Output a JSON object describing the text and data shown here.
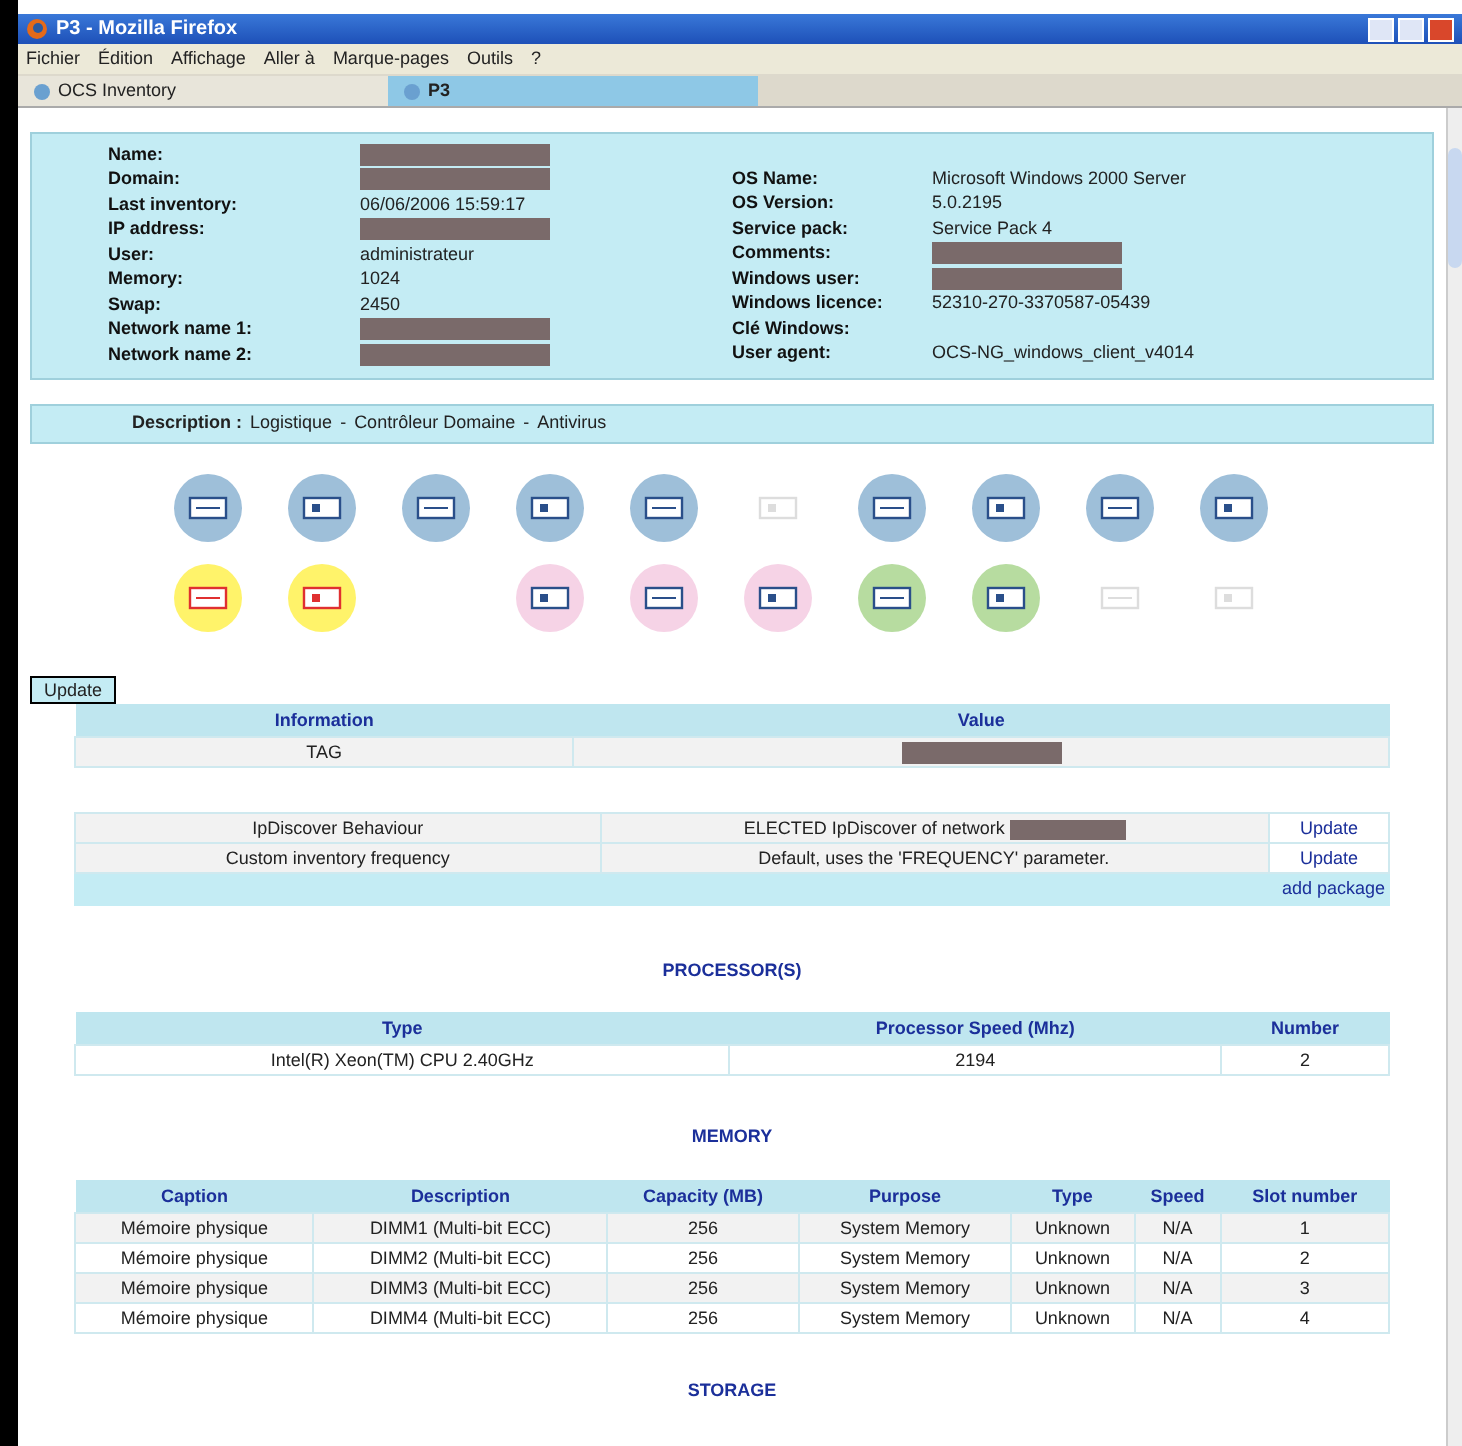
{
  "window": {
    "title": "P3 - Mozilla Firefox"
  },
  "menu": [
    "Fichier",
    "Édition",
    "Affichage",
    "Aller à",
    "Marque-pages",
    "Outils",
    "?"
  ],
  "tabs": [
    {
      "label": "OCS Inventory",
      "selected": false
    },
    {
      "label": "P3",
      "selected": true
    }
  ],
  "summary": {
    "left": [
      {
        "label": "Name:",
        "redacted": true
      },
      {
        "label": "Domain:",
        "redacted": true
      },
      {
        "label": "Last inventory:",
        "value": "06/06/2006 15:59:17"
      },
      {
        "label": "IP address:",
        "redacted": true
      },
      {
        "label": "User:",
        "value": "administrateur"
      },
      {
        "label": "Memory:",
        "value": "1024"
      },
      {
        "label": "Swap:",
        "value": "2450"
      },
      {
        "label": "Network name 1:",
        "redacted": true
      },
      {
        "label": "Network name 2:",
        "redacted": true
      }
    ],
    "right": [
      {
        "label": "OS Name:",
        "value": "Microsoft Windows 2000 Server"
      },
      {
        "label": "OS Version:",
        "value": "5.0.2195"
      },
      {
        "label": "Service pack:",
        "value": "Service Pack 4"
      },
      {
        "label": "Comments:",
        "redacted": true
      },
      {
        "label": "Windows user:",
        "redacted": true
      },
      {
        "label": "Windows licence:",
        "value": "52310-270-3370587-05439"
      },
      {
        "label": "Clé Windows:"
      },
      {
        "label": "User agent:",
        "value": "OCS-NG_windows_client_v4014"
      }
    ]
  },
  "categories": {
    "label": "Description :",
    "separator": "-",
    "links": [
      "Logistique",
      "Contrôleur Domaine",
      "Antivirus"
    ]
  },
  "icon_rows": [
    [
      {
        "kind": "blue"
      },
      {
        "kind": "blue"
      },
      {
        "kind": "blue"
      },
      {
        "kind": "blue"
      },
      {
        "kind": "blue"
      },
      {
        "kind": "faded"
      },
      {
        "kind": "blue"
      },
      {
        "kind": "blue"
      },
      {
        "kind": "blue"
      },
      {
        "kind": "blue"
      }
    ],
    [
      {
        "kind": "yellow"
      },
      {
        "kind": "yellow"
      },
      {
        "kind": "empty"
      },
      {
        "kind": "pink"
      },
      {
        "kind": "pink"
      },
      {
        "kind": "pink"
      },
      {
        "kind": "green"
      },
      {
        "kind": "green"
      },
      {
        "kind": "faded"
      },
      {
        "kind": "faded"
      }
    ]
  ],
  "update_button": "Update",
  "info_table": {
    "columns": [
      "Information",
      "Value"
    ],
    "rows": [
      {
        "information": "TAG",
        "redacted": true
      }
    ]
  },
  "settings_table": {
    "rows": [
      {
        "name": "IpDiscover Behaviour",
        "value": "ELECTED IpDiscover of network ",
        "redacted": true,
        "action": "Update"
      },
      {
        "name": "Custom inventory frequency",
        "value": "Default, uses the 'FREQUENCY' parameter.",
        "redacted": false,
        "action": "Update"
      }
    ],
    "footer_link": "add package"
  },
  "processors": {
    "heading": "PROCESSOR(S)",
    "columns": [
      "Type",
      "Processor Speed (Mhz)",
      "Number"
    ],
    "rows": [
      [
        "Intel(R) Xeon(TM) CPU 2.40GHz",
        "2194",
        "2"
      ]
    ]
  },
  "memory": {
    "heading": "MEMORY",
    "columns": [
      "Caption",
      "Description",
      "Capacity (MB)",
      "Purpose",
      "Type",
      "Speed",
      "Slot number"
    ],
    "rows": [
      [
        "Mémoire physique",
        "DIMM1 (Multi-bit ECC)",
        "256",
        "System Memory",
        "Unknown",
        "N/A",
        "1"
      ],
      [
        "Mémoire physique",
        "DIMM2 (Multi-bit ECC)",
        "256",
        "System Memory",
        "Unknown",
        "N/A",
        "2"
      ],
      [
        "Mémoire physique",
        "DIMM3 (Multi-bit ECC)",
        "256",
        "System Memory",
        "Unknown",
        "N/A",
        "3"
      ],
      [
        "Mémoire physique",
        "DIMM4 (Multi-bit ECC)",
        "256",
        "System Memory",
        "Unknown",
        "N/A",
        "4"
      ]
    ]
  },
  "storage": {
    "heading": "STORAGE"
  }
}
